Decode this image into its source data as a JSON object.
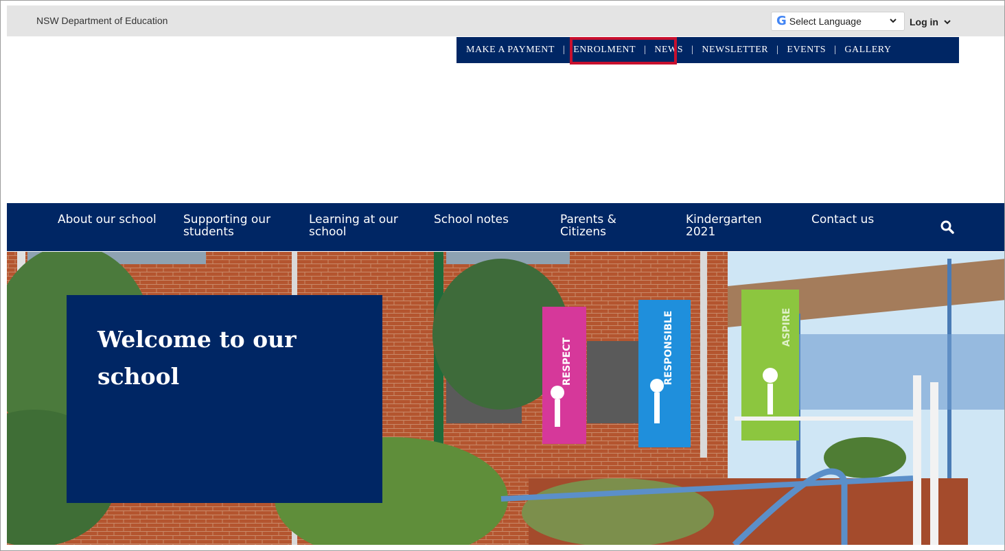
{
  "utility_bar": {
    "department": "NSW Department of Education",
    "language_select": "Select Language",
    "login": "Log in"
  },
  "top_nav": {
    "items": [
      "MAKE A PAYMENT",
      "ENROLMENT",
      "NEWS",
      "NEWSLETTER",
      "EVENTS",
      "GALLERY"
    ],
    "highlighted": "ENROLMENT"
  },
  "main_nav": {
    "items": [
      {
        "line1": "About our school",
        "line2": ""
      },
      {
        "line1": "Supporting our",
        "line2": "students"
      },
      {
        "line1": "Learning at our",
        "line2": "school"
      },
      {
        "line1": "School notes",
        "line2": ""
      },
      {
        "line1": "Parents &",
        "line2": "Citizens"
      },
      {
        "line1": "Kindergarten",
        "line2": "2021"
      },
      {
        "line1": "Contact us",
        "line2": ""
      }
    ]
  },
  "hero": {
    "title_line1": "Welcome to our",
    "title_line2": "school",
    "banners": [
      "RESPECT",
      "RESPONSIBLE",
      "ASPIRE"
    ]
  },
  "colors": {
    "navy": "#002664",
    "highlight_red": "#c8102e",
    "utility_grey": "#e4e4e4",
    "banner_magenta": "#d6389a",
    "banner_blue": "#1f8fdc",
    "banner_green": "#8cc63f"
  }
}
